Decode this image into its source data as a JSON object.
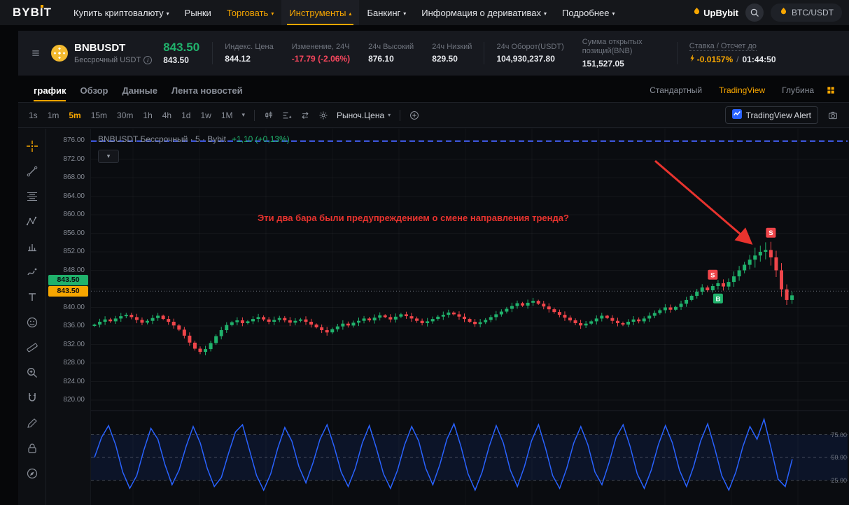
{
  "nav": {
    "logo_prefix": "BYB",
    "logo_suffix": "T",
    "items": [
      {
        "label": "Купить криптовалюту",
        "caret": "▾",
        "tone": "normal",
        "active": false
      },
      {
        "label": "Рынки",
        "caret": "",
        "tone": "normal",
        "active": false
      },
      {
        "label": "Торговать",
        "caret": "▾",
        "tone": "accent",
        "active": false
      },
      {
        "label": "Инструменты",
        "caret": "▴",
        "tone": "accent",
        "active": true
      },
      {
        "label": "Банкинг",
        "caret": "▾",
        "tone": "normal",
        "active": false
      },
      {
        "label": "Информация о деривативах",
        "caret": "▾",
        "tone": "normal",
        "active": false
      },
      {
        "label": "Подробнее",
        "caret": "▾",
        "tone": "normal",
        "active": false
      }
    ],
    "upbybit_label": "UpBybit",
    "pair_pill": "BTC/USDT"
  },
  "ticker": {
    "symbol": "BNBUSDT",
    "contract": "Бессрочный USDT",
    "last_price": "843.50",
    "last_price_sub": "843.50",
    "stats": [
      {
        "label": "Индекс. Цена",
        "value": "844.12",
        "tone": "normal"
      },
      {
        "label": "Изменение, 24Ч",
        "value": "-17.79 (-2.06%)",
        "tone": "down"
      },
      {
        "label": "24ч Высокий",
        "value": "876.10",
        "tone": "normal"
      },
      {
        "label": "24ч Низкий",
        "value": "829.50",
        "tone": "normal"
      },
      {
        "label": "24ч Оборот(USDT)",
        "value": "104,930,237.80",
        "tone": "normal"
      },
      {
        "label": "Сумма открытых позиций(BNB)",
        "value": "151,527.05",
        "tone": "normal",
        "narrow": true
      }
    ],
    "funding": {
      "label": "Ставка / Отсчет до",
      "rate": "-0.0157%",
      "divider": "/",
      "countdown": "01:44:50"
    }
  },
  "tabs": {
    "left": [
      {
        "label": "график",
        "active": true
      },
      {
        "label": "Обзор",
        "active": false
      },
      {
        "label": "Данные",
        "active": false
      },
      {
        "label": "Лента новостей",
        "active": false
      }
    ],
    "right": [
      {
        "label": "Стандартный",
        "active": false
      },
      {
        "label": "TradingView",
        "active": true
      },
      {
        "label": "Глубина",
        "active": false
      }
    ]
  },
  "toolbar": {
    "timeframes": [
      "1s",
      "1m",
      "5m",
      "15m",
      "30m",
      "1h",
      "4h",
      "1d",
      "1w",
      "1M"
    ],
    "active_timeframe": "5m",
    "icons": [
      "chart-style",
      "indicators",
      "compare",
      "settings"
    ],
    "order_type": "Рыноч.Цена",
    "alert_label": "TradingView Alert"
  },
  "tools": [
    "crosshair",
    "trendline",
    "fib-retracement",
    "xabcd-pattern",
    "forecast",
    "brush",
    "text",
    "emoji",
    "ruler",
    "zoom",
    "magnet",
    "pencil",
    "lock",
    "compass"
  ],
  "chart": {
    "legend_title": "BNBUSDT Бессрочный · 5 · Bybit",
    "legend_change": "+1,10 (+0,13%)",
    "annotation": "Эти два бара были предупреждением о смене направления тренда?",
    "price_badges": [
      {
        "value": "843.50",
        "color": "#20b26c"
      },
      {
        "value": "843.50",
        "color": "#f7a600"
      }
    ],
    "colors": {
      "up": "#20b26c",
      "down": "#ef454a",
      "accent": "#f7a600",
      "oscillator": "#2962ff",
      "alert_line": "#4563ff",
      "annotation": "#e8332e"
    }
  },
  "chart_data": {
    "type": "candlestick",
    "title": "BNBUSDT Бессрочный · 5 · Bybit",
    "interval": "5m",
    "price_axis": {
      "min": 818,
      "max": 878,
      "ticks": [
        876,
        872,
        868,
        864,
        860,
        856,
        852,
        848,
        840,
        836,
        832,
        828,
        824,
        820
      ]
    },
    "first_open": 836.0,
    "closes": [
      836.3,
      836.9,
      837.4,
      837.0,
      837.6,
      838.1,
      838.4,
      837.9,
      837.3,
      836.7,
      837.1,
      837.7,
      838.2,
      837.5,
      836.9,
      836.1,
      835.2,
      833.9,
      832.4,
      831.1,
      830.4,
      831.0,
      832.3,
      833.8,
      835.1,
      836.2,
      836.8,
      837.2,
      836.6,
      837.0,
      837.5,
      837.9,
      837.4,
      836.9,
      837.3,
      837.7,
      837.2,
      836.7,
      837.1,
      837.4,
      836.9,
      836.3,
      835.7,
      835.1,
      834.6,
      835.3,
      835.9,
      836.5,
      836.1,
      836.7,
      837.1,
      837.6,
      837.2,
      837.8,
      838.3,
      837.9,
      837.4,
      838.0,
      838.5,
      838.1,
      837.6,
      837.1,
      836.6,
      837.0,
      837.5,
      838.0,
      838.4,
      838.9,
      838.5,
      838.0,
      837.5,
      836.9,
      836.4,
      836.8,
      837.3,
      837.9,
      838.5,
      839.1,
      839.7,
      840.3,
      840.9,
      840.4,
      841.0,
      841.4,
      840.8,
      840.2,
      839.6,
      839.0,
      838.4,
      837.8,
      837.2,
      836.6,
      836.1,
      836.5,
      837.0,
      837.6,
      838.2,
      837.7,
      837.1,
      836.6,
      836.3,
      836.9,
      837.4,
      837.0,
      837.6,
      838.2,
      838.8,
      839.4,
      840.0,
      839.5,
      840.1,
      840.8,
      841.6,
      842.5,
      843.4,
      844.3,
      843.7,
      844.6,
      845.2,
      844.5,
      845.5,
      846.7,
      848.0,
      849.2,
      850.3,
      851.2,
      852.0,
      852.4,
      850.8,
      848.0,
      843.9,
      841.6,
      842.6
    ],
    "markers": [
      {
        "index": 117,
        "side": "S"
      },
      {
        "index": 118,
        "side": "B"
      },
      {
        "index": 128,
        "side": "S"
      }
    ],
    "levels": {
      "alert_line": 875.9,
      "last_price": 843.5
    },
    "oscillator": {
      "upper": 75,
      "middle": 50,
      "lower": 25,
      "axis_labels": [
        "75.00",
        "50.00",
        "25.00"
      ],
      "values": [
        50,
        72,
        85,
        64,
        34,
        16,
        30,
        58,
        82,
        70,
        42,
        20,
        36,
        62,
        84,
        66,
        38,
        18,
        28,
        54,
        78,
        86,
        58,
        30,
        14,
        32,
        60,
        83,
        68,
        40,
        22,
        44,
        70,
        86,
        62,
        34,
        18,
        38,
        66,
        85,
        60,
        32,
        16,
        36,
        64,
        84,
        68,
        38,
        20,
        42,
        70,
        87,
        62,
        32,
        14,
        34,
        62,
        85,
        66,
        36,
        18,
        40,
        68,
        86,
        60,
        30,
        16,
        38,
        66,
        84,
        64,
        34,
        20,
        44,
        72,
        86,
        62,
        32,
        16,
        36,
        64,
        85,
        66,
        36,
        18,
        40,
        68,
        87,
        60,
        30,
        14,
        34,
        62,
        84,
        70,
        92,
        60,
        26,
        18,
        48
      ]
    }
  }
}
